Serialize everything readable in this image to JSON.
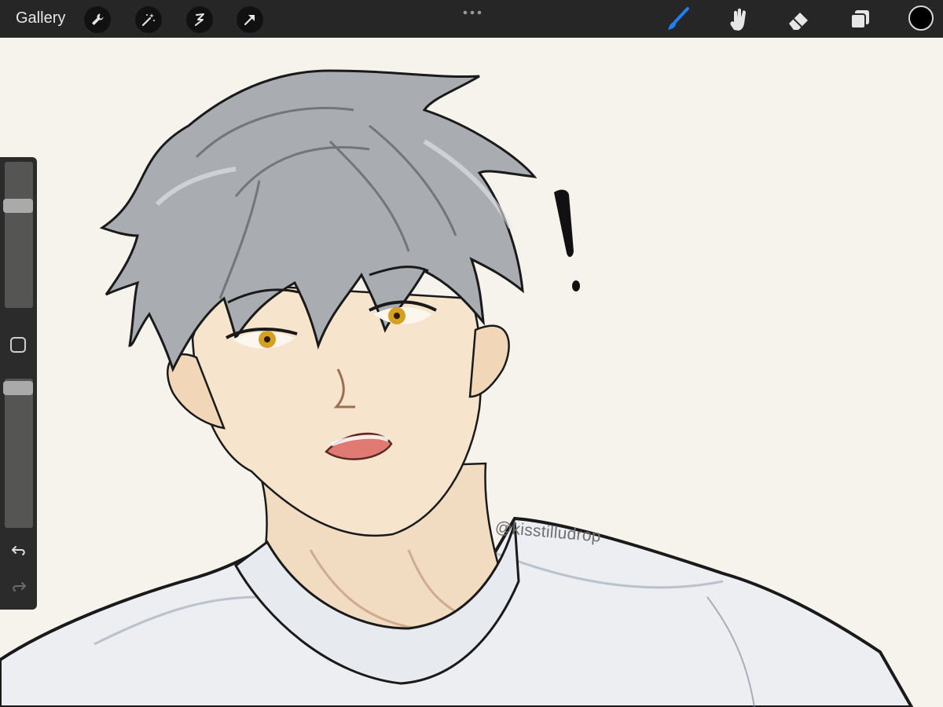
{
  "toolbar": {
    "gallery_label": "Gallery",
    "left_tools": [
      "wrench-icon",
      "magic-wand-icon",
      "selection-icon",
      "transform-arrow-icon"
    ],
    "right_tools": [
      "brush-icon",
      "smudge-icon",
      "eraser-icon",
      "layers-icon"
    ],
    "active_tool": "brush-icon",
    "accent_color": "#1f7ff5",
    "current_color": "#000000"
  },
  "sidebar": {
    "brush_size_level": 0.28,
    "opacity_level": 0.02,
    "modify_button_icon": "square-icon",
    "undo_icon": "undo-icon",
    "redo_icon": "redo-icon"
  },
  "canvas": {
    "watermark": "@kisstilludrop",
    "background_color": "#f6f2ec"
  }
}
